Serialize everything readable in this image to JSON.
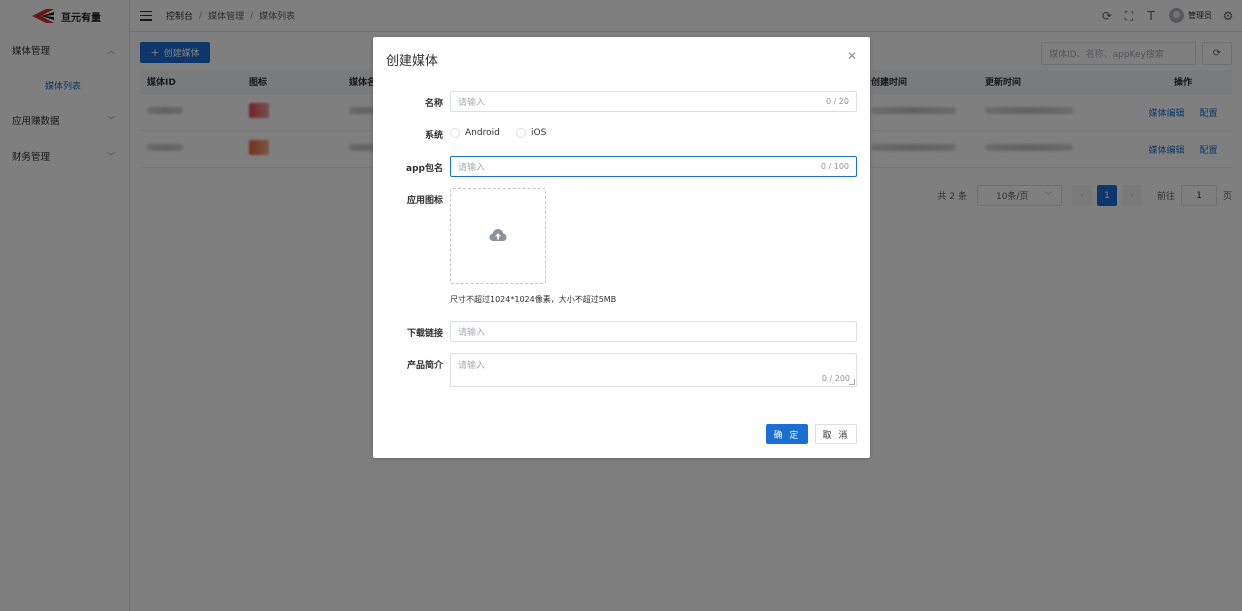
{
  "app": {
    "logo_text": "亘元有量"
  },
  "sidebar": {
    "groups": [
      {
        "label": "媒体管理",
        "expanded": true,
        "children": [
          {
            "label": "媒体列表",
            "active": true
          }
        ]
      },
      {
        "label": "应用赚数据",
        "expanded": false
      },
      {
        "label": "财务管理",
        "expanded": false
      }
    ]
  },
  "header": {
    "breadcrumb": [
      "控制台",
      "媒体管理",
      "媒体列表"
    ],
    "username": "管理员",
    "icons": [
      "refresh-icon",
      "fullscreen-icon",
      "font-size-icon",
      "settings-icon"
    ]
  },
  "toolbar": {
    "create_label": "创建媒体",
    "search_placeholder": "媒体ID、名称、appKey搜索"
  },
  "table": {
    "columns": {
      "id": "媒体ID",
      "icon": "图标",
      "name": "媒体名",
      "created": "创建时间",
      "updated": "更新时间",
      "ops": "操作"
    },
    "rows": [
      {
        "icon_color": "#e04a4a",
        "op_edit": "媒体编辑",
        "op_config": "配置"
      },
      {
        "icon_color": "#e8603a",
        "op_edit": "媒体编辑",
        "op_config": "配置"
      }
    ]
  },
  "pagination": {
    "total": "共 2 条",
    "page_size": "10条/页",
    "current_page": "1",
    "goto_prefix": "前往",
    "goto_value": "1",
    "goto_suffix": "页"
  },
  "dialog": {
    "title": "创建媒体",
    "fields": {
      "name": {
        "label": "名称",
        "placeholder": "请输入",
        "count": "0 / 20"
      },
      "system": {
        "label": "系统",
        "options": [
          "Android",
          "iOS"
        ]
      },
      "package": {
        "label": "app包名",
        "placeholder": "请输入",
        "count": "0 / 100"
      },
      "icon": {
        "label": "应用图标",
        "hint": "尺寸不超过1024*1024像素，大小不超过5MB"
      },
      "download": {
        "label": "下载链接",
        "placeholder": "请输入"
      },
      "intro": {
        "label": "产品简介",
        "placeholder": "请输入",
        "count": "0 / 200"
      }
    },
    "confirm_label": "确 定",
    "cancel_label": "取 消"
  },
  "colors": {
    "primary": "#1a6fd4",
    "overlay": "rgba(0,0,0,0.5)"
  }
}
